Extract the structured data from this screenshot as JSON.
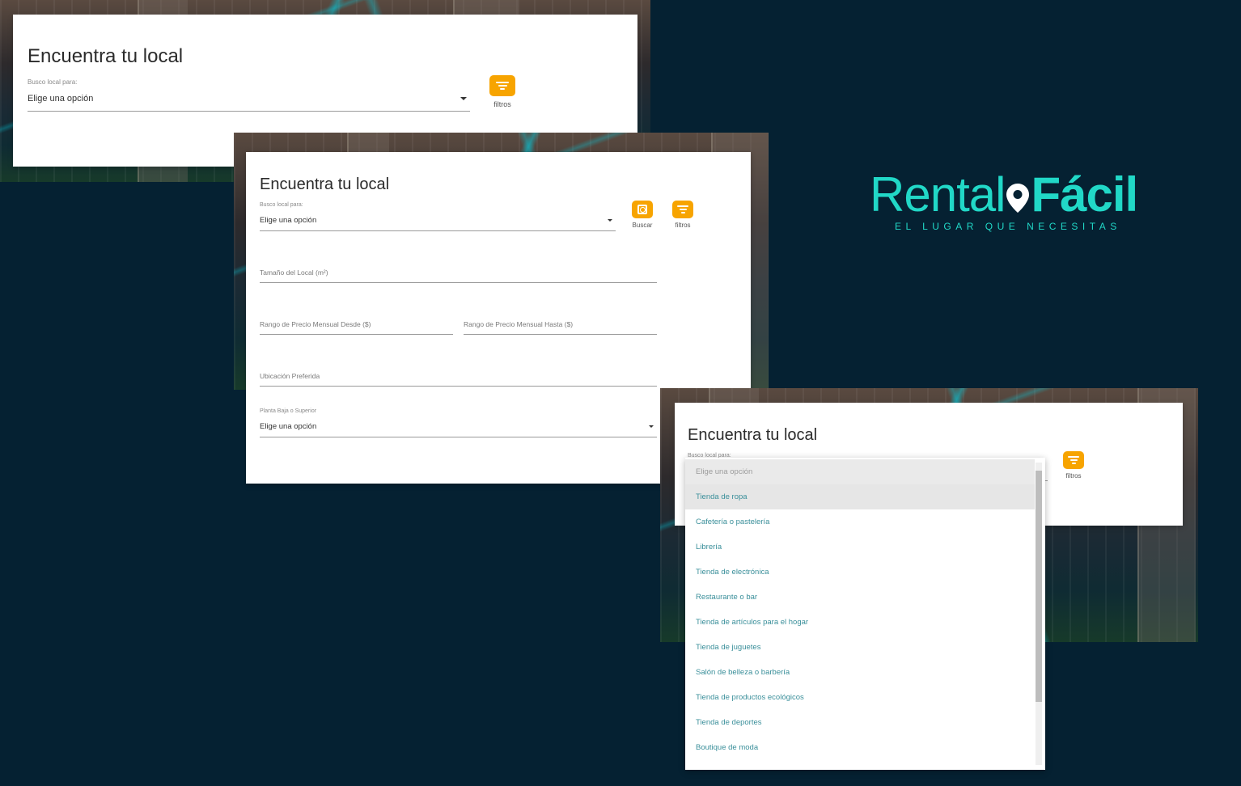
{
  "card1": {
    "title": "Encuentra tu local",
    "select_label": "Busco local para:",
    "select_value": "Elige una opción",
    "filter_label": "filtros"
  },
  "card2": {
    "title": "Encuentra tu local",
    "select_label": "Busco local para:",
    "select_value": "Elige una opción",
    "search_label": "Buscar",
    "filter_label": "filtros",
    "size_placeholder": "Tamaño del Local (m²)",
    "price_from_placeholder": "Rango de Precio Mensual Desde ($)",
    "price_to_placeholder": "Rango de Precio Mensual Hasta ($)",
    "location_placeholder": "Ubicación Preferida",
    "floor_label": "Planta Baja o Superior",
    "floor_value": "Elige una opción"
  },
  "card3": {
    "title": "Encuentra tu local",
    "select_label": "Busco local para:",
    "filter_label": "filtros",
    "options": [
      "Elige una opción",
      "Tienda de ropa",
      "Cafetería o pastelería",
      "Librería",
      "Tienda de electrónica",
      "Restaurante o bar",
      "Tienda de artículos para el hogar",
      "Tienda de juguetes",
      "Salón de belleza o barbería",
      "Tienda de productos ecológicos",
      "Tienda de deportes",
      "Boutique de moda"
    ]
  },
  "logo": {
    "brand_part1": "Rental",
    "brand_part2": "Fácil",
    "tagline": "EL LUGAR QUE NECESITAS"
  },
  "colors": {
    "background": "#052132",
    "accent": "#f7a400",
    "brand": "#21d8c7",
    "option_text": "#3a8f9a"
  }
}
